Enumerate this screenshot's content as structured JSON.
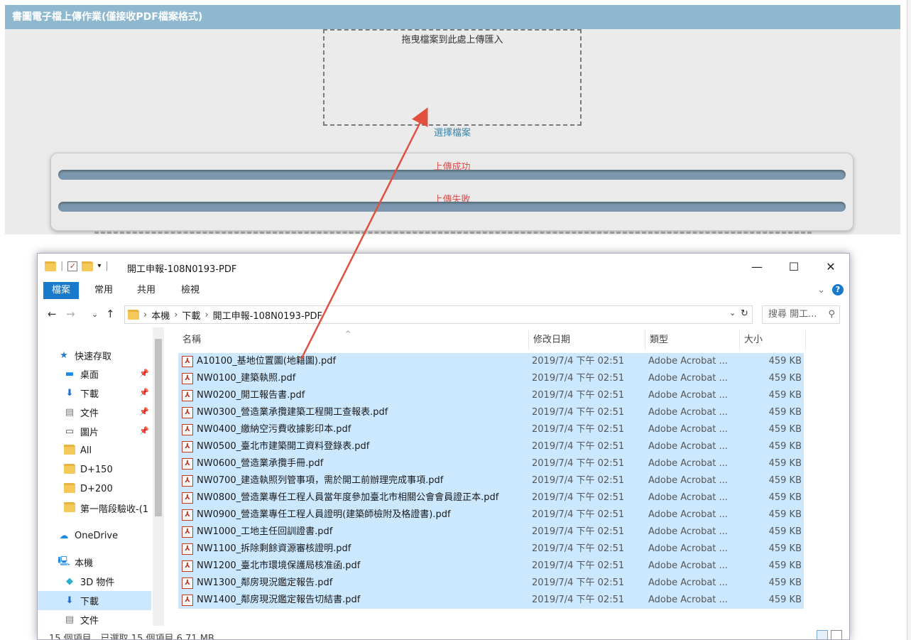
{
  "page": {
    "header_title": "書圖電子檔上傳作業(僅接收PDF檔案格式)",
    "dropzone_text": "拖曳檔案到此處上傳匯入",
    "select_files": "選擇檔案",
    "upload_success": "上傳成功",
    "upload_failed": "上傳失敗"
  },
  "explorer": {
    "title": "開工申報-108N0193-PDF",
    "ribbon_tabs": [
      "檔案",
      "常用",
      "共用",
      "檢視"
    ],
    "breadcrumb": [
      "本機",
      "下載",
      "開工申報-108N0193-PDF"
    ],
    "search_placeholder": "搜尋 開工...",
    "columns": {
      "name": "名稱",
      "date": "修改日期",
      "type": "類型",
      "size": "大小"
    },
    "nav_items": [
      {
        "label": "快速存取",
        "icon": "star-icon"
      },
      {
        "label": "桌面",
        "icon": "desktop-icon"
      },
      {
        "label": "下載",
        "icon": "download-icon"
      },
      {
        "label": "文件",
        "icon": "document-icon"
      },
      {
        "label": "圖片",
        "icon": "picture-icon"
      },
      {
        "label": "All",
        "icon": "folder-icon"
      },
      {
        "label": "D+150",
        "icon": "folder-icon"
      },
      {
        "label": "D+200",
        "icon": "folder-icon"
      },
      {
        "label": "第一階段驗收-(1",
        "icon": "folder-icon"
      },
      {
        "label": "OneDrive",
        "icon": "cloud-icon"
      },
      {
        "label": "本機",
        "icon": "computer-icon"
      },
      {
        "label": "3D 物件",
        "icon": "cube-icon"
      },
      {
        "label": "下載",
        "icon": "download-icon"
      },
      {
        "label": "文件",
        "icon": "document-icon"
      }
    ],
    "files": [
      {
        "name": "A10100_基地位置圖(地籍圖).pdf",
        "date": "2019/7/4 下午 02:51",
        "type": "Adobe Acrobat ...",
        "size": "459 KB"
      },
      {
        "name": "NW0100_建築執照.pdf",
        "date": "2019/7/4 下午 02:51",
        "type": "Adobe Acrobat ...",
        "size": "459 KB"
      },
      {
        "name": "NW0200_開工報告書.pdf",
        "date": "2019/7/4 下午 02:51",
        "type": "Adobe Acrobat ...",
        "size": "459 KB"
      },
      {
        "name": "NW0300_營造業承攬建築工程開工查報表.pdf",
        "date": "2019/7/4 下午 02:51",
        "type": "Adobe Acrobat ...",
        "size": "459 KB"
      },
      {
        "name": "NW0400_繳納空污費收據影印本.pdf",
        "date": "2019/7/4 下午 02:51",
        "type": "Adobe Acrobat ...",
        "size": "459 KB"
      },
      {
        "name": "NW0500_臺北市建築開工資料登錄表.pdf",
        "date": "2019/7/4 下午 02:51",
        "type": "Adobe Acrobat ...",
        "size": "459 KB"
      },
      {
        "name": "NW0600_營造業承攬手冊.pdf",
        "date": "2019/7/4 下午 02:51",
        "type": "Adobe Acrobat ...",
        "size": "459 KB"
      },
      {
        "name": "NW0700_建造執照列管事項，需於開工前辦理完成事項.pdf",
        "date": "2019/7/4 下午 02:51",
        "type": "Adobe Acrobat ...",
        "size": "459 KB"
      },
      {
        "name": "NW0800_營造業專任工程人員當年度參加臺北市相關公會會員證正本.pdf",
        "date": "2019/7/4 下午 02:51",
        "type": "Adobe Acrobat ...",
        "size": "459 KB"
      },
      {
        "name": "NW0900_營造業專任工程人員證明(建築師檢附及格證書).pdf",
        "date": "2019/7/4 下午 02:51",
        "type": "Adobe Acrobat ...",
        "size": "459 KB"
      },
      {
        "name": "NW1000_工地主任回訓證書.pdf",
        "date": "2019/7/4 下午 02:51",
        "type": "Adobe Acrobat ...",
        "size": "459 KB"
      },
      {
        "name": "NW1100_拆除剩餘資源審核證明.pdf",
        "date": "2019/7/4 下午 02:51",
        "type": "Adobe Acrobat ...",
        "size": "459 KB"
      },
      {
        "name": "NW1200_臺北市環境保護局核准函.pdf",
        "date": "2019/7/4 下午 02:51",
        "type": "Adobe Acrobat ...",
        "size": "459 KB"
      },
      {
        "name": "NW1300_鄰房現況鑑定報告.pdf",
        "date": "2019/7/4 下午 02:51",
        "type": "Adobe Acrobat ...",
        "size": "459 KB"
      },
      {
        "name": "NW1400_鄰房現況鑑定報告切結書.pdf",
        "date": "2019/7/4 下午 02:51",
        "type": "Adobe Acrobat ...",
        "size": "459 KB"
      }
    ],
    "status": "15 個項目　已選取 15 個項目 6.71 MB"
  },
  "colors": {
    "header": "#8db8ce",
    "link": "#3a87ad",
    "status_red": "#d9534f",
    "selection": "#cce8ff",
    "arrow": "#e05040"
  }
}
